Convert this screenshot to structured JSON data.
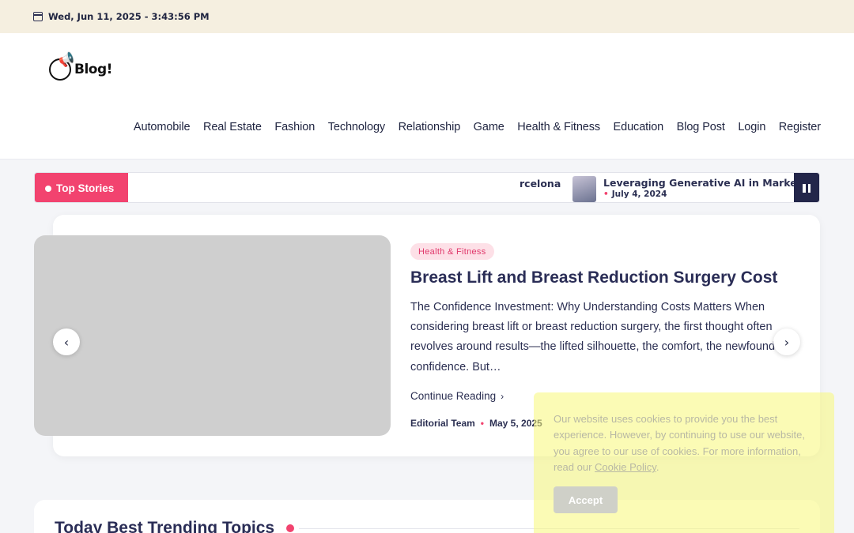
{
  "topbar": {
    "date": "Wed, Jun 11, 2025 - 3:43:56 PM",
    "icon": "calendar-icon"
  },
  "logo": {
    "text": "Blog!"
  },
  "nav": {
    "items": [
      "Automobile",
      "Real Estate",
      "Fashion",
      "Technology",
      "Relationship",
      "Game",
      "Health & Fitness",
      "Education",
      "Blog Post",
      "Login",
      "Register"
    ]
  },
  "ticker": {
    "label": "Top Stories",
    "fragment": "rcelona",
    "item_title": "Leveraging Generative AI in Marketing",
    "item_date": "July 4, 2024"
  },
  "featured": {
    "category": "Health & Fitness",
    "title": "Breast Lift and Breast Reduction Surgery Cost",
    "excerpt": "The Confidence Investment: Why Understanding Costs Matters When considering breast lift or breast reduction surgery, the first thought often revolves around results—the lifted silhouette, the comfort, the newfound confidence. But…",
    "continue_label": "Continue Reading",
    "author": "Editorial Team",
    "date": "May 5, 2025"
  },
  "trending": {
    "title": "Today Best Trending Topics"
  },
  "cookie": {
    "text_before": "Our website uses cookies to provide you the best experience. However, by continuing to use our website, you agree to our use of cookies. For more information, read our ",
    "policy_link": "Cookie Policy",
    "text_after": ".",
    "accept_label": "Accept"
  },
  "colors": {
    "accent": "#f2436f",
    "navy": "#23264a",
    "topbar_bg": "#f5efe0"
  }
}
